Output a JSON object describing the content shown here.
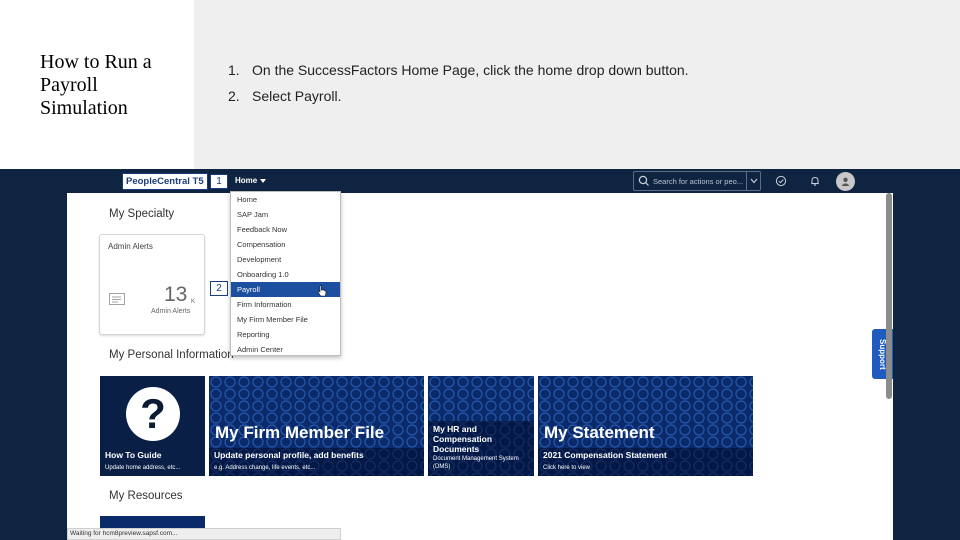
{
  "slide": {
    "title": "How to Run a Payroll Simulation",
    "steps": [
      {
        "num": "1.",
        "text": "On the SuccessFactors Home Page, click the home drop down button."
      },
      {
        "num": "2.",
        "text": "Select Payroll."
      }
    ]
  },
  "app": {
    "logo": "PeopleCentral T5",
    "home_menu_label": "Home",
    "search_placeholder": "Search for actions or peo...",
    "callouts": [
      "1",
      "2"
    ],
    "icons": [
      "search-icon",
      "chevron-down-icon",
      "check-circle-icon",
      "bell-icon",
      "user-avatar-icon",
      "list-icon",
      "cursor-hand-icon"
    ],
    "sections": {
      "my_specialty": "My Specialty",
      "my_personal_information": "My Personal Information",
      "my_resources": "My Resources"
    },
    "admin_tile": {
      "title": "Admin Alerts",
      "value": "13",
      "unit": "K",
      "subtitle": "Admin Alerts"
    },
    "home_dropdown": {
      "items": [
        "Home",
        "SAP Jam",
        "Feedback Now",
        "Compensation",
        "Development",
        "Onboarding 1.0",
        "Payroll",
        "Firm Information",
        "My Firm Member File",
        "Reporting",
        "Admin Center"
      ],
      "highlighted": "Payroll"
    },
    "cards": [
      {
        "big": "",
        "sub": "How To Guide",
        "small": "Update home address, etc..."
      },
      {
        "big": "My Firm Member File",
        "sub": "Update personal profile, add benefits",
        "small": "e.g. Address change, life events, etc..."
      },
      {
        "big": "My HR and Compensation Documents",
        "sub": "",
        "small": "Document Management System (DMS)"
      },
      {
        "big": "My Statement",
        "sub": "2021 Compensation Statement",
        "small": "Click here to view"
      }
    ],
    "support_label": "Support",
    "status_text": "Waiting for hcm8preview.sapsf.com...",
    "colors": {
      "topbar": "#0f2440",
      "accent": "#1d4fa0",
      "card_bg": "#0a2a6a"
    }
  }
}
